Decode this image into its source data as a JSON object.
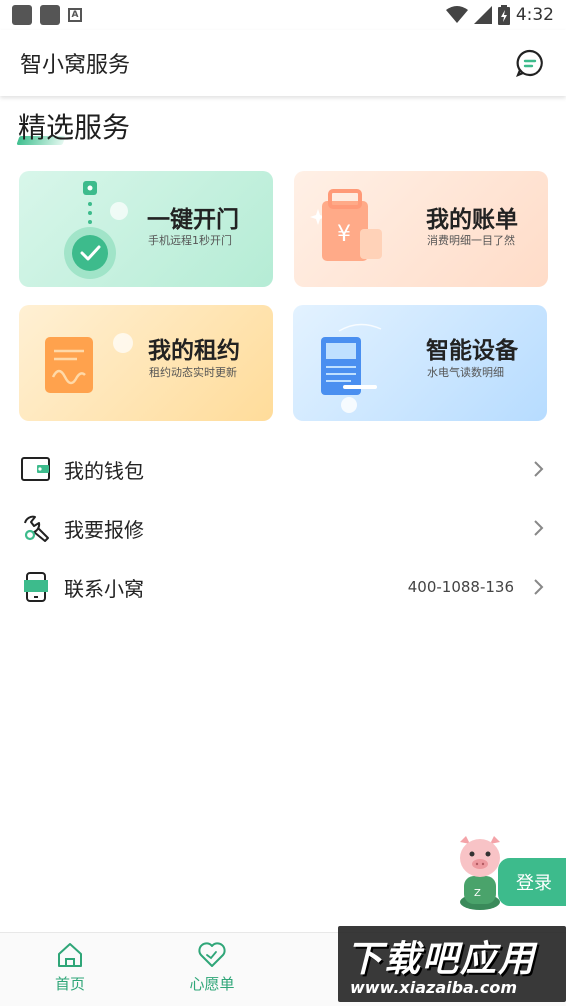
{
  "status_bar": {
    "time": "4:32"
  },
  "header": {
    "title": "智小窝服务"
  },
  "section": {
    "title": "精选服务"
  },
  "cards": [
    {
      "title": "一键开门",
      "subtitle": "手机远程1秒开门"
    },
    {
      "title": "我的账单",
      "subtitle": "消费明细一目了然"
    },
    {
      "title": "我的租约",
      "subtitle": "租约动态实时更新"
    },
    {
      "title": "智能设备",
      "subtitle": "水电气读数明细"
    }
  ],
  "list": [
    {
      "label": "我的钱包",
      "value": ""
    },
    {
      "label": "我要报修",
      "value": ""
    },
    {
      "label": "联系小窝",
      "value": "400-1088-136"
    }
  ],
  "login": {
    "label": "登录"
  },
  "bottom_nav": [
    {
      "label": "首页"
    },
    {
      "label": "心愿单"
    }
  ],
  "watermark": {
    "main": "下载吧应用",
    "sub": "www.xiazaiba.com"
  },
  "colors": {
    "accent": "#3dbb8c"
  }
}
